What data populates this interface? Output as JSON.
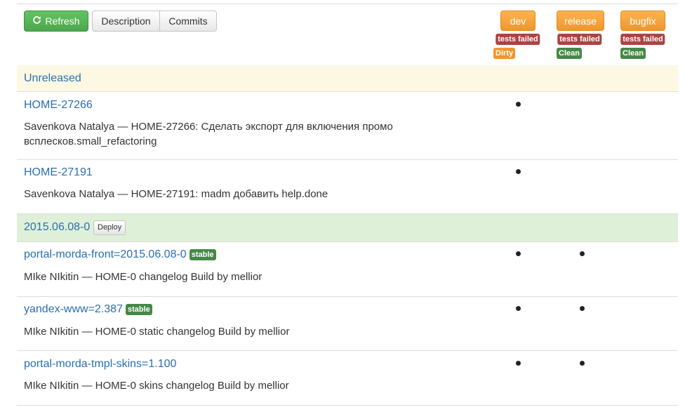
{
  "toolbar": {
    "refresh_label": "Refresh",
    "refresh_icon": "refresh-icon",
    "description_label": "Description",
    "commits_label": "Commits"
  },
  "branches": [
    {
      "name": "dev",
      "tests": "tests failed",
      "state": "Dirty"
    },
    {
      "name": "release",
      "tests": "tests failed",
      "state": "Clean"
    },
    {
      "name": "bugfix",
      "tests": "tests failed",
      "state": "Clean"
    }
  ],
  "sections": {
    "unreleased": "Unreleased",
    "release": {
      "title": "2015.06.08-0",
      "deploy_label": "Deploy"
    }
  },
  "commits": [
    {
      "id": "HOME-27266",
      "text": "Savenkova Natalya — HOME-27266: Сделать экспорт для включения промо всплесков.small_refactoring",
      "in_dev": true,
      "in_release": false
    },
    {
      "id": "HOME-27191",
      "text": "Savenkova Natalya — HOME-27191: madm добавить help.done",
      "in_dev": true,
      "in_release": false
    },
    {
      "id": "portal-morda-front=2015.06.08-0",
      "badge": "stable",
      "text": "MIke NIkitin — HOME-0 changelog Build by mellior",
      "in_dev": true,
      "in_release": true
    },
    {
      "id": "yandex-www=2.387",
      "badge": "stable",
      "text": "MIke NIkitin — HOME-0 static changelog Build by mellior",
      "in_dev": true,
      "in_release": true
    },
    {
      "id": "portal-morda-tmpl-skins=1.100",
      "text": "MIke NIkitin — HOME-0 skins changelog Build by mellior",
      "in_dev": true,
      "in_release": true
    }
  ],
  "colors": {
    "accent_link": "#2a6fb0",
    "refresh_green": "#5cb85c",
    "branch_orange": "#f0962c",
    "danger": "#a94442",
    "success": "#468847",
    "unreleased_bg": "#fcf8e3",
    "release_bg": "#dff0d8"
  }
}
